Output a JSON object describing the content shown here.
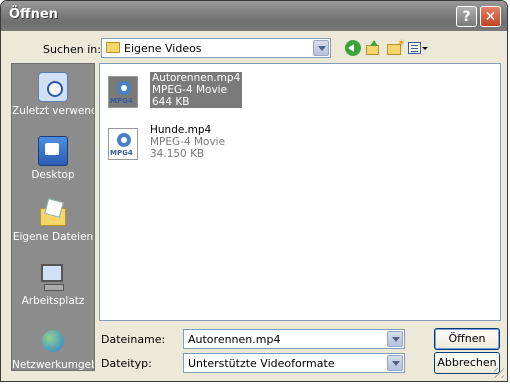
{
  "window": {
    "title": "Öffnen",
    "help_label": "?",
    "close_label": "✕"
  },
  "toolbar": {
    "lookin_label": "Suchen in:",
    "lookin_value": "Eigene Videos",
    "icons": [
      "back-icon",
      "up-folder-icon",
      "new-folder-icon",
      "views-menu-icon"
    ]
  },
  "places": [
    {
      "label": "Zuletzt verwendete D...",
      "icon": "recent-documents-icon"
    },
    {
      "label": "Desktop",
      "icon": "desktop-icon"
    },
    {
      "label": "Eigene Dateien",
      "icon": "my-documents-icon"
    },
    {
      "label": "Arbeitsplatz",
      "icon": "my-computer-icon"
    },
    {
      "label": "Netzwerkumgeb",
      "icon": "network-icon"
    }
  ],
  "files": [
    {
      "name": "Autorennen.mp4",
      "type": "MPEG-4 Movie",
      "size": "644 KB",
      "icon_tag": "MPG4",
      "selected": true
    },
    {
      "name": "Hunde.mp4",
      "type": "MPEG-4 Movie",
      "size": "34.150 KB",
      "icon_tag": "MPG4",
      "selected": false
    }
  ],
  "form": {
    "filename_label": "Dateiname:",
    "filename_value": "Autorennen.mp4",
    "filetype_label": "Dateityp:",
    "filetype_value": "Unterstützte Videoformate",
    "open_label": "Öffnen",
    "cancel_label": "Abbrechen"
  },
  "colors": {
    "title_bar": "#828282",
    "places_bar": "#8c8c8c",
    "selection": "#7a7a7a",
    "dialog_bg": "#ece9d8"
  }
}
